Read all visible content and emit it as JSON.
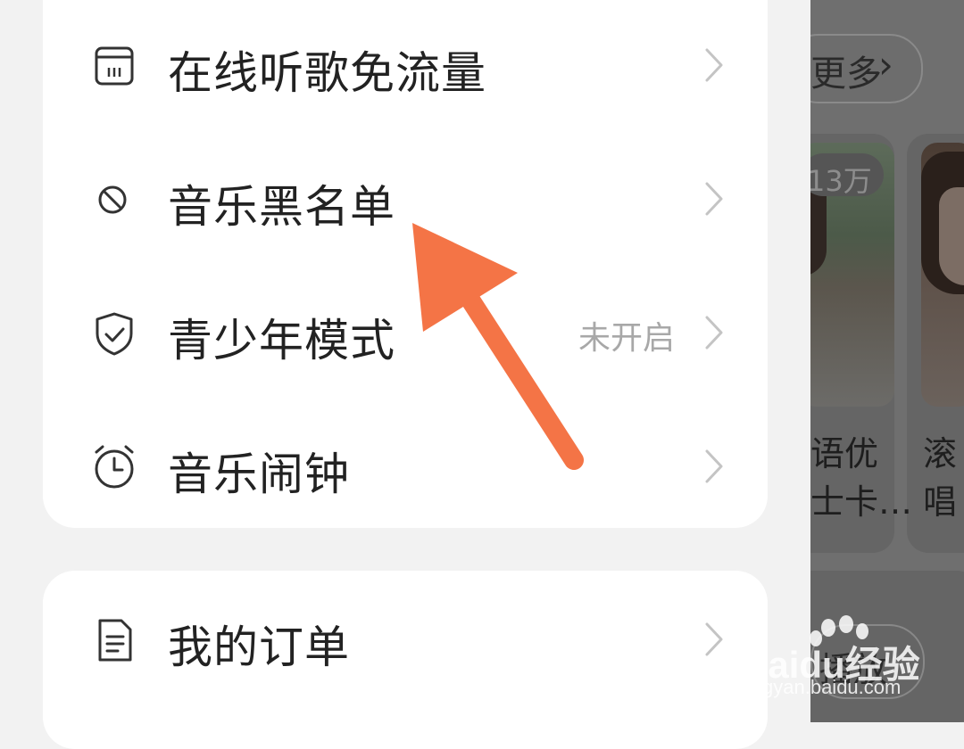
{
  "background": {
    "more_label": "更多",
    "play_count": "13万",
    "card1_caption": [
      "语优",
      "士卡…"
    ],
    "card2_caption": [
      "滚",
      "唱"
    ],
    "play_label": "播放"
  },
  "menu": {
    "items": [
      {
        "label": "在线听歌免流量",
        "icon": "sim-card-icon",
        "status": ""
      },
      {
        "label": "音乐黑名单",
        "icon": "block-icon",
        "status": ""
      },
      {
        "label": "青少年模式",
        "icon": "shield-check-icon",
        "status": "未开启"
      },
      {
        "label": "音乐闹钟",
        "icon": "alarm-clock-icon",
        "status": ""
      }
    ],
    "items2": [
      {
        "label": "我的订单",
        "icon": "document-icon",
        "status": ""
      }
    ]
  },
  "annotation": {
    "arrow_color": "#F47446"
  },
  "watermark": {
    "brand": "Baidu经验",
    "sub": "jingyan.baidu.com"
  }
}
